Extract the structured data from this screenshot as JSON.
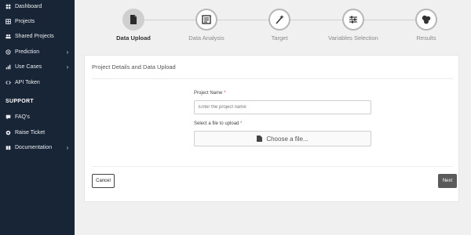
{
  "sidebar": {
    "items": [
      {
        "label": "Dashboard",
        "icon": "dashboard-icon"
      },
      {
        "label": "Projects",
        "icon": "projects-icon"
      },
      {
        "label": "Shared Projects",
        "icon": "shared-projects-icon"
      },
      {
        "label": "Prediction",
        "icon": "prediction-icon",
        "chevron": "›"
      },
      {
        "label": "Use Cases",
        "icon": "use-cases-icon",
        "chevron": "›"
      },
      {
        "label": "API Token",
        "icon": "code-icon"
      }
    ],
    "support_title": "SUPPORT",
    "support_items": [
      {
        "label": "FAQ's",
        "icon": "faq-icon"
      },
      {
        "label": "Raise Ticket",
        "icon": "ticket-icon"
      },
      {
        "label": "Documentation",
        "icon": "documentation-icon",
        "chevron": "›"
      }
    ]
  },
  "steps": [
    {
      "label": "Data Upload",
      "icon": "file-upload-icon",
      "active": true
    },
    {
      "label": "Data Analysis",
      "icon": "data-analysis-icon",
      "active": false
    },
    {
      "label": "Target",
      "icon": "magic-wand-icon",
      "active": false
    },
    {
      "label": "Variables Selection",
      "icon": "sliders-icon",
      "active": false
    },
    {
      "label": "Results",
      "icon": "results-icon",
      "active": false
    }
  ],
  "form": {
    "title": "Project Details and Data Upload",
    "project_name_label": "Project Name",
    "project_name_placeholder": "Enter the project name",
    "project_name_value": "",
    "file_label": "Select a file to upload",
    "required_mark": "*",
    "file_button_label": "Choose a file...",
    "cancel_label": "Cancel",
    "next_label": "Next"
  },
  "colors": {
    "sidebar_bg": "#182536",
    "page_bg": "#f0f0f0",
    "next_button_bg": "#5a5a5a",
    "required": "#d9534f"
  }
}
